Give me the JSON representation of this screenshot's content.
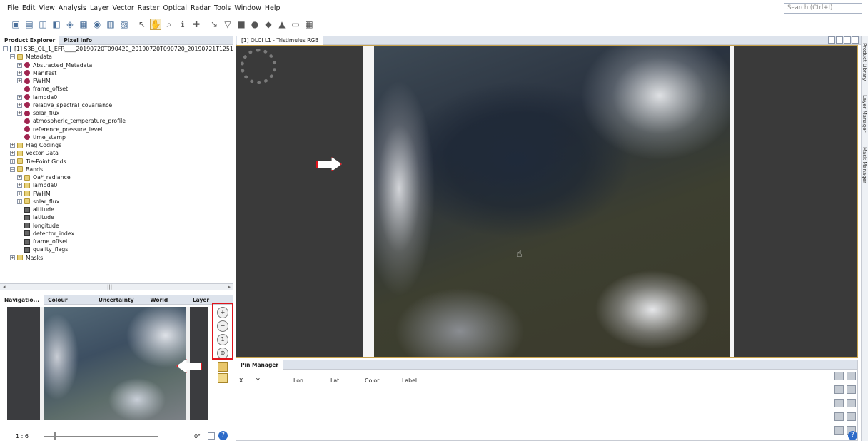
{
  "menu": [
    "File",
    "Edit",
    "View",
    "Analysis",
    "Layer",
    "Vector",
    "Raster",
    "Optical",
    "Radar",
    "Tools",
    "Window",
    "Help"
  ],
  "search": {
    "placeholder": "Search (Ctrl+I)"
  },
  "toolbar_icons": [
    "open-product-icon",
    "save-product-icon",
    "band-maths-icon",
    "filter-icon",
    "spectral-icon",
    "gcp-icon",
    "pin-icon",
    "ruler-icon",
    "mask-icon",
    "select-tool-icon",
    "pan-tool-icon",
    "zoom-tool-icon",
    "pixel-info-icon",
    "gcp-tool-icon",
    "line-tool-icon",
    "polygon-tool-icon",
    "rect-tool-icon",
    "ellipse-tool-icon",
    "fill-icon",
    "range-finder-icon",
    "magic-wand-icon",
    "tile-icon"
  ],
  "explorer_tabs": {
    "product_explorer": "Product Explorer",
    "pixel_info": "Pixel Info"
  },
  "product": {
    "name": "[1] S3B_OL_1_EFR____20190720T090420_20190720T090720_20190721T1251"
  },
  "tree": [
    {
      "label": "Metadata",
      "level": 1,
      "icon": "folder"
    },
    {
      "label": "Abstracted_Metadata",
      "level": 2,
      "icon": "meta"
    },
    {
      "label": "Manifest",
      "level": 2,
      "icon": "meta"
    },
    {
      "label": "FWHM",
      "level": 2,
      "icon": "meta"
    },
    {
      "label": "frame_offset",
      "level": 2,
      "icon": "meta"
    },
    {
      "label": "lambda0",
      "level": 2,
      "icon": "meta"
    },
    {
      "label": "relative_spectral_covariance",
      "level": 2,
      "icon": "meta"
    },
    {
      "label": "solar_flux",
      "level": 2,
      "icon": "meta"
    },
    {
      "label": "atmospheric_temperature_profile",
      "level": 2,
      "icon": "meta"
    },
    {
      "label": "reference_pressure_level",
      "level": 2,
      "icon": "meta"
    },
    {
      "label": "time_stamp",
      "level": 2,
      "icon": "meta"
    },
    {
      "label": "Flag Codings",
      "level": 1,
      "icon": "folder"
    },
    {
      "label": "Vector Data",
      "level": 1,
      "icon": "folder"
    },
    {
      "label": "Tie-Point Grids",
      "level": 1,
      "icon": "folder"
    },
    {
      "label": "Bands",
      "level": 1,
      "icon": "folder"
    },
    {
      "label": "Oa*_radiance",
      "level": 2,
      "icon": "folder"
    },
    {
      "label": "lambda0",
      "level": 2,
      "icon": "folder"
    },
    {
      "label": "FWHM",
      "level": 2,
      "icon": "folder"
    },
    {
      "label": "solar_flux",
      "level": 2,
      "icon": "folder"
    },
    {
      "label": "altitude",
      "level": 2,
      "icon": "band"
    },
    {
      "label": "latitude",
      "level": 2,
      "icon": "band"
    },
    {
      "label": "longitude",
      "level": 2,
      "icon": "band"
    },
    {
      "label": "detector_index",
      "level": 2,
      "icon": "band"
    },
    {
      "label": "frame_offset",
      "level": 2,
      "icon": "band"
    },
    {
      "label": "quality_flags",
      "level": 2,
      "icon": "band"
    },
    {
      "label": "Masks",
      "level": 1,
      "icon": "folder"
    }
  ],
  "nav_tabs": [
    "Navigatio...",
    "Colour Mani...",
    "Uncertainty ...",
    "World View",
    "Layer Editor"
  ],
  "nav": {
    "scale": "1 : 6",
    "angle": "0°"
  },
  "view_tab": "[1] OLCI L1 - Tristimulus RGB",
  "pin_manager": {
    "title": "Pin Manager",
    "columns": [
      "X",
      "Y",
      "Lon",
      "Lat",
      "Color",
      "Label"
    ]
  },
  "right_sidebar": [
    "Product Library",
    "Layer Manager",
    "Mask Manager"
  ],
  "accent": "#e0141c"
}
